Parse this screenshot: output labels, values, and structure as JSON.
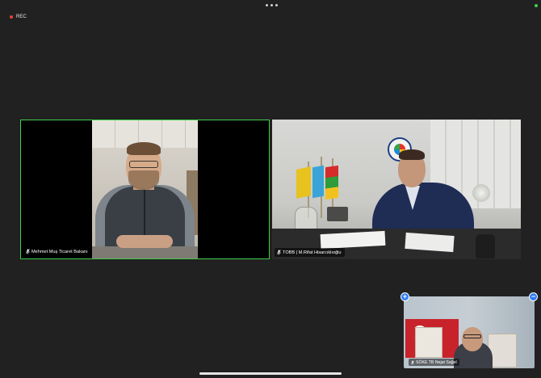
{
  "recording": {
    "label": "REC",
    "indicator_color": "#e8403a"
  },
  "status_indicator_color": "#3ecf4a",
  "active_speaker_border_color": "#3fce4a",
  "participants": [
    {
      "name": "Mehmet Muş Ticaret Bakanı",
      "mic_icon": "mic-muted-icon",
      "active_speaker": true
    },
    {
      "name": "TOBB | M.Rifat Hisarcıklıoğlu",
      "mic_icon": "mic-muted-icon",
      "active_speaker": false
    }
  ],
  "self_view": {
    "name": "SÖKE TB  Nejat Sağel",
    "mic_icon": "mic-muted-icon",
    "expand_icon": "plus-icon",
    "minimize_icon": "minus-icon",
    "expand_symbol": "+",
    "minimize_symbol": "−"
  },
  "top_bar_icon": "more-dots-icon"
}
